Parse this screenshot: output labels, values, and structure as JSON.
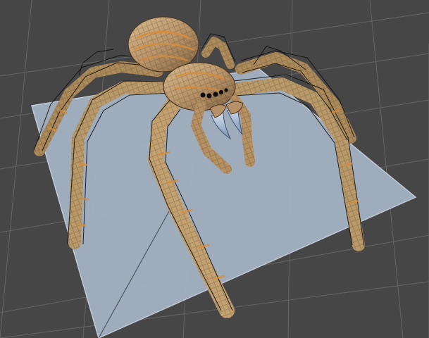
{
  "viewport": {
    "kind": "3d-scene-viewport",
    "background_color": "#464646",
    "grid_color": "#6a6a6a",
    "ground_plane_color": "#a4b2c3",
    "ground_plane_edge_color": "#c7d2de",
    "model_wireframe_color": "#151515",
    "model_base_color": "#b89469",
    "model_highlight_color": "#e3c79b",
    "model_stripe_color": "#d68d3d",
    "fang_color": "#a3b5cf"
  }
}
